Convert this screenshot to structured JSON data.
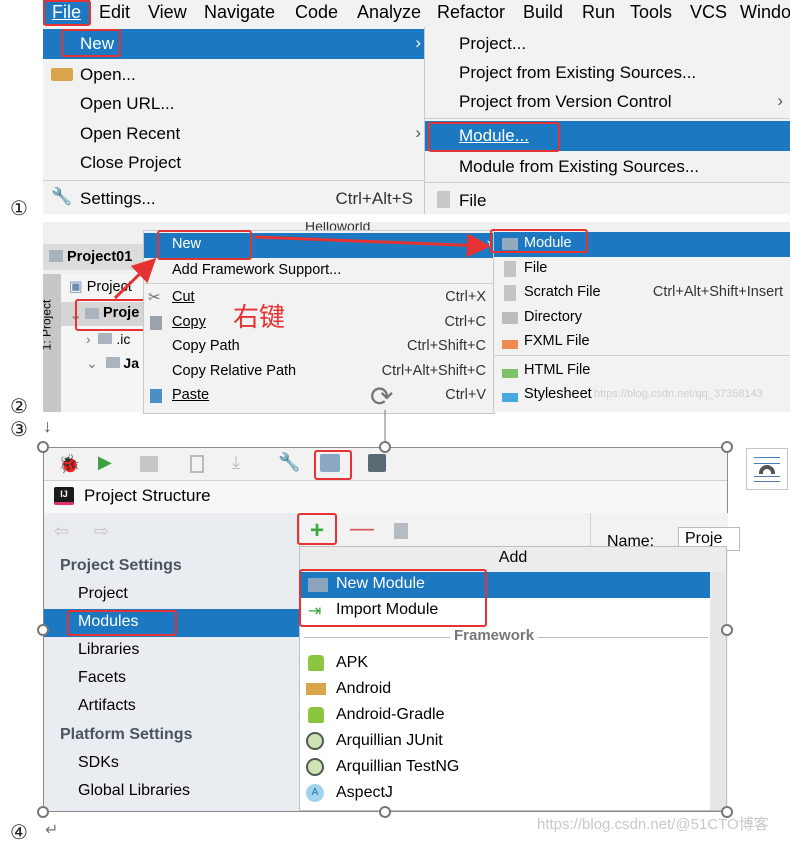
{
  "step_labels": [
    "①",
    "②",
    "③",
    "④"
  ],
  "step3_arrow": "↓",
  "step4_return": "↵",
  "section1": {
    "menubar": [
      "File",
      "Edit",
      "View",
      "Navigate",
      "Code",
      "Analyze",
      "Refactor",
      "Build",
      "Run",
      "Tools",
      "VCS",
      "Windo"
    ],
    "file_menu": [
      {
        "label": "New",
        "submenu": true,
        "selected": true
      },
      {
        "label": "Open...",
        "icon": "folder-open-icon"
      },
      {
        "label": "Open URL..."
      },
      {
        "label": "Open Recent",
        "submenu": true
      },
      {
        "label": "Close Project"
      },
      {
        "label": "Settings...",
        "shortcut": "Ctrl+Alt+S",
        "icon": "wrench-icon"
      }
    ],
    "new_submenu": [
      {
        "label": "Project..."
      },
      {
        "label": "Project from Existing Sources..."
      },
      {
        "label": "Project from Version Control",
        "submenu": true
      },
      {
        "label": "Module...",
        "selected": true
      },
      {
        "label": "Module from Existing Sources..."
      },
      {
        "label": "File",
        "icon": "file-icon"
      }
    ]
  },
  "section2": {
    "toolbar_run_config": "Helloworld",
    "project_tab": "Project01",
    "side_tool": "1: Project",
    "tree": [
      {
        "label": "Project",
        "icon": "project-view-icon"
      },
      {
        "label": "Proje",
        "icon": "module-folder-icon",
        "bold": true
      },
      {
        "label": ".ic",
        "icon": "folder-icon"
      },
      {
        "label": "Ja",
        "icon": "module-folder-icon",
        "bold": true
      }
    ],
    "annotation": "右键",
    "context_menu": [
      {
        "label": "New",
        "selected": true,
        "submenu": true
      },
      {
        "label": "Add Framework Support..."
      },
      {
        "label": "Cut",
        "shortcut": "Ctrl+X",
        "icon": "scissors-icon"
      },
      {
        "label": "Copy",
        "shortcut": "Ctrl+C",
        "icon": "copy-icon"
      },
      {
        "label": "Copy Path",
        "shortcut": "Ctrl+Shift+C"
      },
      {
        "label": "Copy Relative Path",
        "shortcut": "Ctrl+Alt+Shift+C"
      },
      {
        "label": "Paste",
        "shortcut": "Ctrl+V",
        "icon": "paste-icon"
      }
    ],
    "new_submenu": [
      {
        "label": "Module",
        "selected": true,
        "icon": "module-folder-icon"
      },
      {
        "label": "File",
        "icon": "file-icon"
      },
      {
        "label": "Scratch File",
        "shortcut": "Ctrl+Alt+Shift+Insert",
        "icon": "scratch-file-icon"
      },
      {
        "label": "Directory",
        "icon": "folder-icon"
      },
      {
        "label": "FXML File",
        "icon": "fxml-file-icon"
      },
      {
        "label": "HTML File",
        "icon": "html-file-icon"
      },
      {
        "label": "Stylesheet",
        "icon": "css-file-icon"
      }
    ],
    "watermark": "https://blog.csdn.net/qq_37358143"
  },
  "section3": {
    "dialog_title": "Project Structure",
    "left_nav": [
      {
        "label": "Project Settings",
        "header": true
      },
      {
        "label": "Project"
      },
      {
        "label": "Modules",
        "selected": true
      },
      {
        "label": "Libraries"
      },
      {
        "label": "Facets"
      },
      {
        "label": "Artifacts"
      },
      {
        "label": "Platform Settings",
        "header": true
      },
      {
        "label": "SDKs"
      },
      {
        "label": "Global Libraries"
      }
    ],
    "name_label": "Name:",
    "name_value": "Proje",
    "add_popup": {
      "title": "Add",
      "items": [
        {
          "label": "New Module",
          "selected": true,
          "icon": "module-folder-icon"
        },
        {
          "label": "Import Module",
          "icon": "import-icon"
        }
      ],
      "group_label": "Framework",
      "frameworks": [
        {
          "label": "APK",
          "icon": "android-icon"
        },
        {
          "label": "Android",
          "icon": "android-folder-icon"
        },
        {
          "label": "Android-Gradle",
          "icon": "android-icon"
        },
        {
          "label": "Arquillian JUnit",
          "icon": "arquillian-icon"
        },
        {
          "label": "Arquillian TestNG",
          "icon": "arquillian-icon"
        },
        {
          "label": "AspectJ",
          "icon": "aspectj-icon"
        }
      ]
    }
  },
  "footer_watermark": "https://blog.csdn.net/@51CTO博客",
  "colors": {
    "selection": "#1c78c0",
    "annotation_red": "#e53232"
  }
}
